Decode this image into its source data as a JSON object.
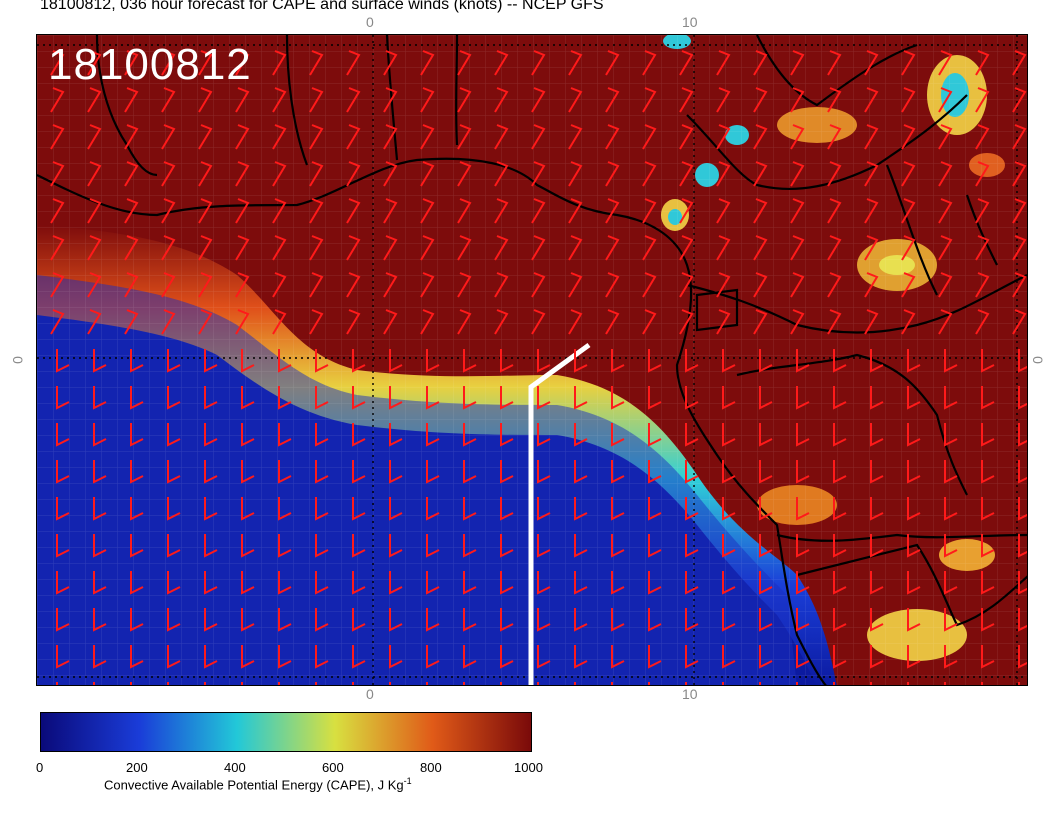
{
  "title": "18100812, 036 hour forecast for CAPE and surface winds (knots) -- NCEP GFS",
  "date_stamp": "18100812",
  "axis_ticks": {
    "top": [
      "0",
      "10"
    ],
    "bottom": [
      "0",
      "10"
    ],
    "left": "0",
    "right": "0"
  },
  "colorbar": {
    "title": "Convective Available Potential Energy (CAPE), J Kg",
    "title_sup": "-1",
    "tick_labels": [
      "0",
      "200",
      "400",
      "600",
      "800",
      "1000"
    ],
    "range": [
      0,
      1000
    ],
    "colors": [
      "#0a0a7a",
      "#1a3cd8",
      "#22c8d8",
      "#d8e040",
      "#e05a18",
      "#7a0a0a"
    ]
  },
  "colors": {
    "land_cape": "#7d0c0c",
    "ocean_cape": "#0c1aa0",
    "wind_barb": "#ff1a1a",
    "coastline": "#000000",
    "cross_section_line": "#ffffff"
  }
}
